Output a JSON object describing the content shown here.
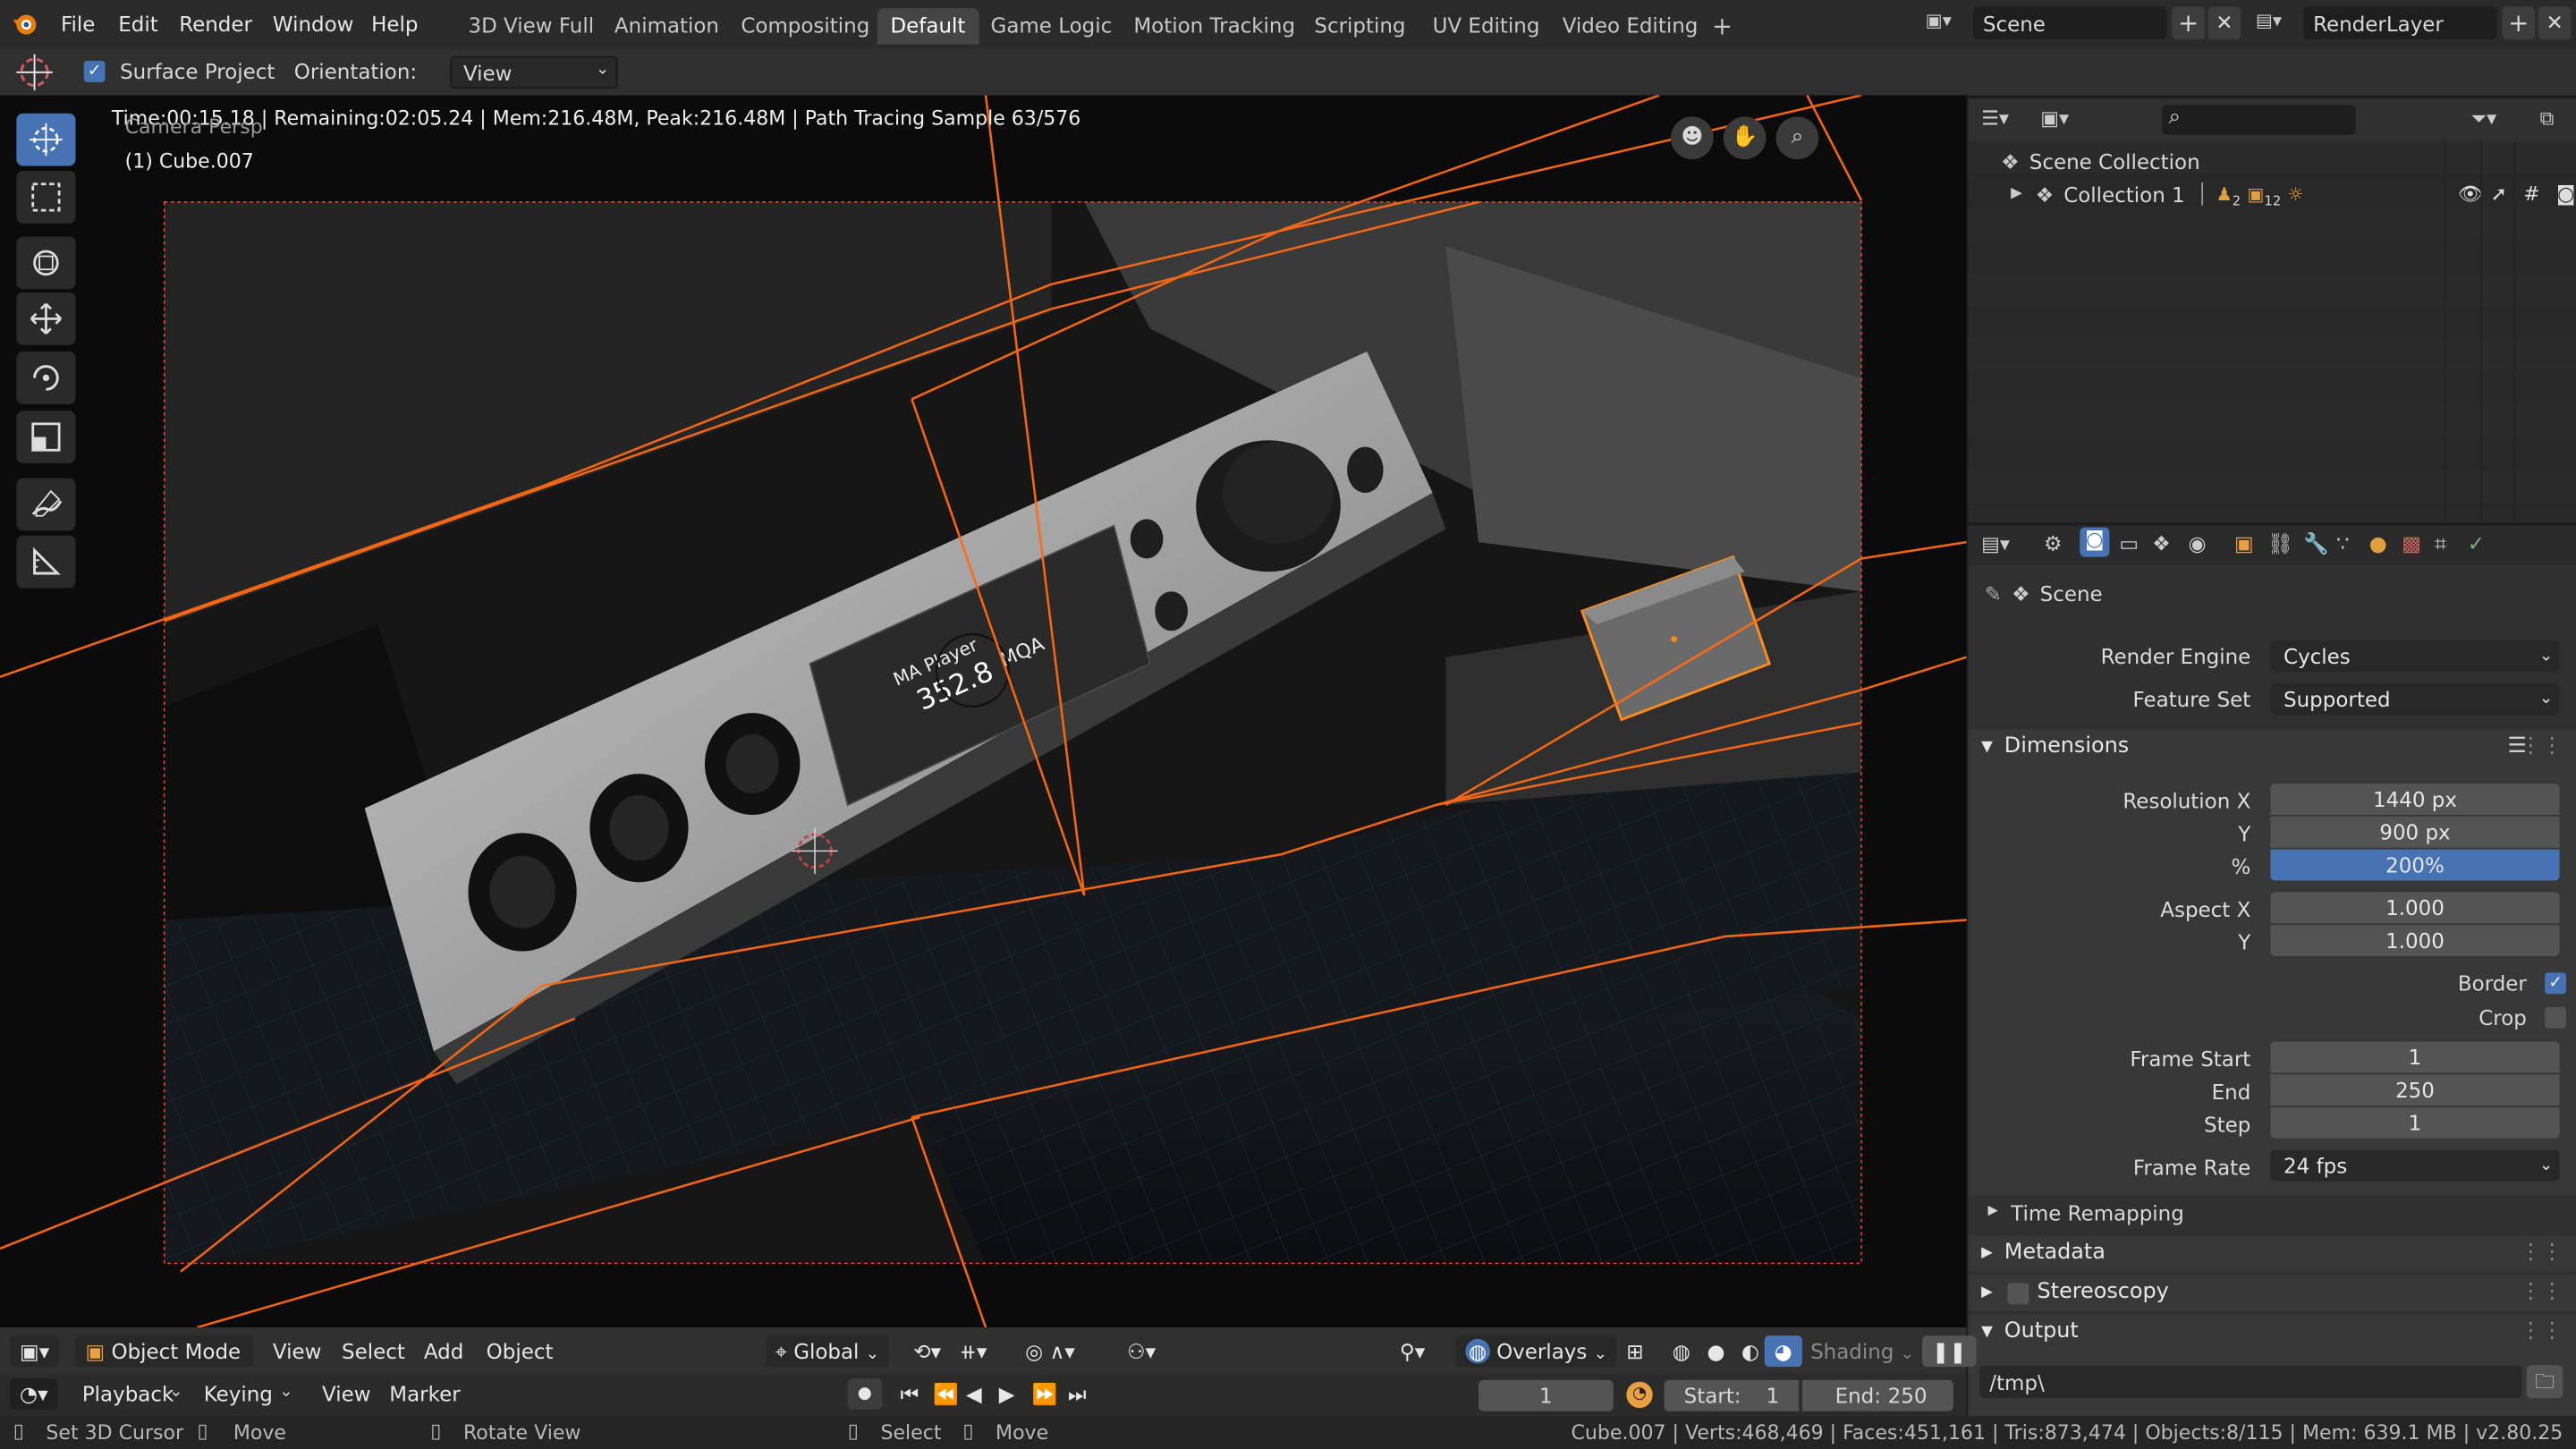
{
  "menu": {
    "items": [
      "File",
      "Edit",
      "Render",
      "Window",
      "Help"
    ]
  },
  "workspaces": {
    "tabs": [
      "3D View Full",
      "Animation",
      "Compositing",
      "Default",
      "Game Logic",
      "Motion Tracking",
      "Scripting",
      "UV Editing",
      "Video Editing"
    ],
    "active": "Default",
    "add_label": "+"
  },
  "scene": {
    "name": "Scene",
    "render_layer": "RenderLayer"
  },
  "tool_header": {
    "surface_project_label": "Surface Project",
    "surface_project_checked": true,
    "orientation_label": "Orientation:",
    "orientation_value": "View"
  },
  "viewport": {
    "render_info": "Time:00:15.18 | Remaining:02:05.24 | Mem:216.48M, Peak:216.48M | Path Tracing Sample 63/576",
    "view_name": "Camera Persp",
    "object_name": "(1) Cube.007",
    "device": {
      "screen_line1": "MA Player",
      "screen_line2": "352.8",
      "screen_brand": "MQA"
    }
  },
  "toolbar": {
    "tools": [
      "cursor-tool",
      "select-box-tool",
      "transform-tool",
      "move-tool",
      "rotate-tool",
      "scale-tool",
      "annotate-tool",
      "measure-tool"
    ],
    "active": "cursor-tool"
  },
  "outliner": {
    "search_placeholder": "",
    "scene_collection": "Scene Collection",
    "collection": "Collection 1",
    "collection_badges": [
      "2",
      "12"
    ]
  },
  "properties": {
    "context": "Scene",
    "render_engine_label": "Render Engine",
    "render_engine": "Cycles",
    "feature_set_label": "Feature Set",
    "feature_set": "Supported",
    "dimensions": {
      "title": "Dimensions",
      "res_x_label": "Resolution X",
      "res_x": "1440 px",
      "res_y_label": "Y",
      "res_y": "900 px",
      "res_pct_label": "%",
      "res_pct": "200%",
      "res_pct_fraction": 1.0,
      "aspect_x_label": "Aspect X",
      "aspect_x": "1.000",
      "aspect_y_label": "Y",
      "aspect_y": "1.000",
      "border_label": "Border",
      "border_checked": true,
      "crop_label": "Crop",
      "crop_checked": false,
      "frame_start_label": "Frame Start",
      "frame_start": "1",
      "frame_end_label": "End",
      "frame_end": "250",
      "frame_step_label": "Step",
      "frame_step": "1",
      "frame_rate_label": "Frame Rate",
      "frame_rate": "24 fps"
    },
    "panels": {
      "time_remapping": "Time Remapping",
      "metadata": "Metadata",
      "stereoscopy": "Stereoscopy",
      "output": "Output"
    },
    "output_path": "/tmp\\"
  },
  "viewport_header": {
    "mode": "Object Mode",
    "menus": [
      "View",
      "Select",
      "Add",
      "Object"
    ],
    "orientation": "Global",
    "overlays": "Overlays",
    "shading": "Shading"
  },
  "timeline": {
    "menus": [
      "Playback",
      "Keying",
      "View",
      "Marker"
    ],
    "current_frame": "1",
    "start_label": "Start:",
    "start": "1",
    "end_label": "End:",
    "end": "250"
  },
  "statusbar": {
    "left": [
      {
        "icon": "mouse-left-icon",
        "label": "Set 3D Cursor"
      },
      {
        "icon": "mouse-middle-icon",
        "label": "Move"
      },
      {
        "icon": "mouse-right-icon",
        "label": "Rotate View"
      },
      {
        "icon": "mouse-left-icon",
        "label": "Select"
      },
      {
        "icon": "mouse-middle-icon",
        "label": "Move"
      }
    ],
    "stats": "Cube.007 | Verts:468,469 | Faces:451,161 | Tris:873,474 | Objects:8/115 | Mem: 639.1 MB | v2.80.25"
  },
  "colors": {
    "accent_blue": "#4772b3",
    "selection_orange": "#ff6a14",
    "panel_bg": "#303030",
    "active_orange_dot": "#ff8c1a"
  }
}
